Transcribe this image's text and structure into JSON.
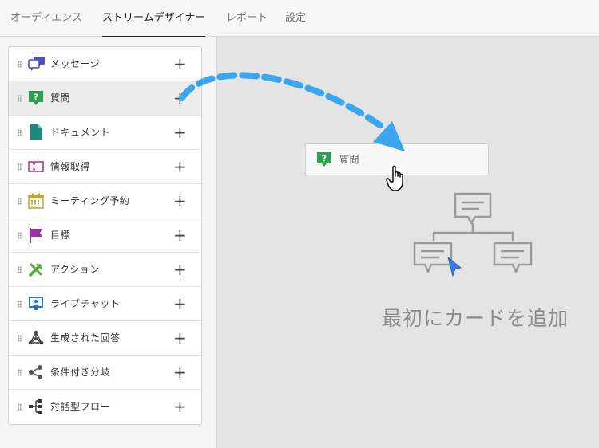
{
  "nav": {
    "tabs": [
      {
        "label": "オーディエンス",
        "active": false
      },
      {
        "label": "ストリームデザイナー",
        "active": true
      },
      {
        "label": "レポート",
        "active": false
      },
      {
        "label": "設定",
        "active": false
      }
    ]
  },
  "card_list": {
    "items": [
      {
        "label": "メッセージ",
        "icon": "message-bubbles-icon",
        "add_label": "+"
      },
      {
        "label": "質問",
        "icon": "question-icon",
        "add_label": "+"
      },
      {
        "label": "ドキュメント",
        "icon": "document-icon",
        "add_label": "+"
      },
      {
        "label": "情報取得",
        "icon": "text-input-icon",
        "add_label": "+"
      },
      {
        "label": "ミーティング予約",
        "icon": "calendar-icon",
        "add_label": "+"
      },
      {
        "label": "目標",
        "icon": "flag-icon",
        "add_label": "+"
      },
      {
        "label": "アクション",
        "icon": "tools-icon",
        "add_label": "+"
      },
      {
        "label": "ライブチャット",
        "icon": "live-chat-icon",
        "add_label": "+"
      },
      {
        "label": "生成された回答",
        "icon": "network-icon",
        "add_label": "+"
      },
      {
        "label": "条件付き分岐",
        "icon": "share-branch-icon",
        "add_label": "+"
      },
      {
        "label": "対話型フロー",
        "icon": "flow-icon",
        "add_label": "+"
      }
    ]
  },
  "canvas": {
    "dragged_card": {
      "label": "質問",
      "icon": "question-icon"
    },
    "empty_state_text": "最初にカードを追加",
    "colors": {
      "arrow": "#3aa6ee",
      "icon_gray": "#9a9a9a",
      "cursor_blue": "#3b7be6"
    }
  },
  "colors": {
    "message": "#4a4fc4",
    "question": "#2f9e52",
    "document": "#1e8a7e",
    "info": "#c0308a",
    "calendar": "#c8a12a",
    "goal": "#9b2fa8",
    "action": "#5aa43a",
    "livechat": "#1f79b8",
    "generated": "#444444",
    "branch": "#555555",
    "flow": "#333333"
  }
}
